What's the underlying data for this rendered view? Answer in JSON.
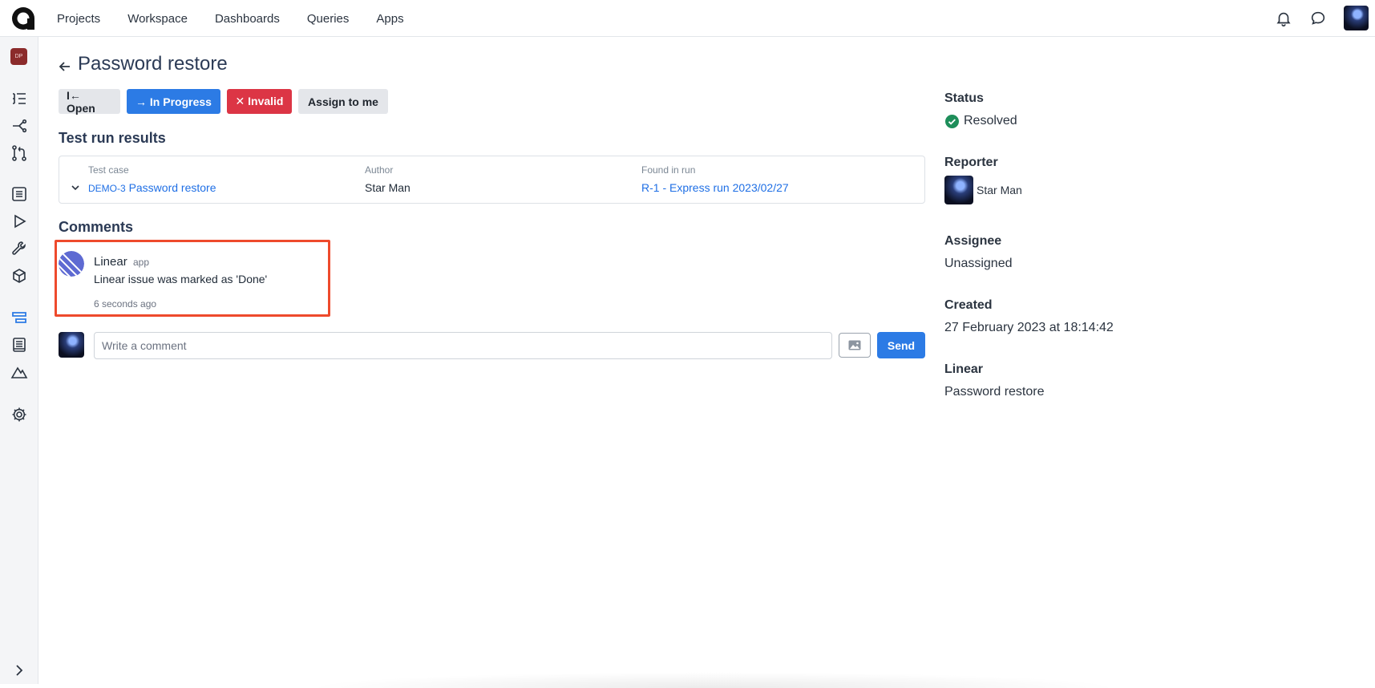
{
  "nav": {
    "items": [
      "Projects",
      "Workspace",
      "Dashboards",
      "Queries",
      "Apps"
    ]
  },
  "sidebar": {
    "project_badge": "DP"
  },
  "page": {
    "title": "Password restore"
  },
  "actions": {
    "open": "I← Open",
    "in_progress": "→ In Progress",
    "invalid": "✕ Invalid",
    "assign": "Assign to me"
  },
  "test_run": {
    "section_title": "Test run results",
    "headers": {
      "test_case": "Test case",
      "author": "Author",
      "found_in_run": "Found in run"
    },
    "row": {
      "case_id": "DEMO-3",
      "case_title": "Password restore",
      "author": "Star Man",
      "run": "R-1 - Express run 2023/02/27"
    }
  },
  "comments": {
    "section_title": "Comments",
    "items": [
      {
        "author": "Linear",
        "tag": "app",
        "text": "Linear issue was marked as 'Done'",
        "time": "6 seconds ago"
      }
    ],
    "input_placeholder": "Write a comment",
    "send_label": "Send"
  },
  "details": {
    "status_label": "Status",
    "status_value": "Resolved",
    "reporter_label": "Reporter",
    "reporter_value": "Star Man",
    "assignee_label": "Assignee",
    "assignee_value": "Unassigned",
    "created_label": "Created",
    "created_value": "27 February 2023 at 18:14:42",
    "linear_label": "Linear",
    "linear_value": "Password restore"
  },
  "colors": {
    "primary": "#2c7be5",
    "danger": "#dc3545",
    "success": "#1e8e5a",
    "highlight": "#ee4a2c",
    "link": "#1f6fe5"
  }
}
